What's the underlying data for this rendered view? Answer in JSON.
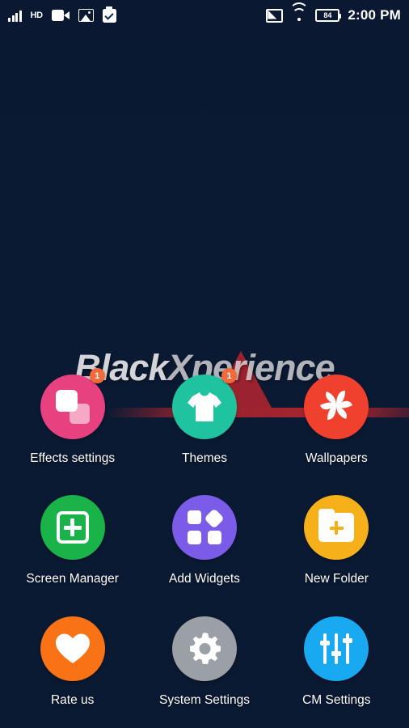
{
  "status_bar": {
    "left_icons": [
      "signal-bars-icon",
      "hd-icon",
      "video-camera-icon",
      "image-icon",
      "checkbox-checked-icon"
    ],
    "hd_label": "HD",
    "right_icons": [
      "cast-screen-icon",
      "wifi-icon",
      "battery-icon"
    ],
    "battery_level": "84",
    "clock": "2:00 PM"
  },
  "watermark": {
    "part1": "Black",
    "part2": "Xperience"
  },
  "apps": [
    {
      "label": "Effects settings",
      "icon": "effects-squares-icon",
      "color": "#e8417f",
      "badge": "1"
    },
    {
      "label": "Themes",
      "icon": "t-shirt-icon",
      "color": "#1fc3a0",
      "badge": "1"
    },
    {
      "label": "Wallpapers",
      "icon": "shutter-flower-icon",
      "color": "#f0402e",
      "badge": ""
    },
    {
      "label": "Screen Manager",
      "icon": "screen-plus-icon",
      "color": "#19b34a",
      "badge": ""
    },
    {
      "label": "Add Widgets",
      "icon": "widgets-shapes-icon",
      "color": "#7a5ce8",
      "badge": ""
    },
    {
      "label": "New Folder",
      "icon": "folder-plus-icon",
      "color": "#f6b01a",
      "badge": ""
    },
    {
      "label": "Rate us",
      "icon": "heart-icon",
      "color": "#f97316",
      "badge": ""
    },
    {
      "label": "System Settings",
      "icon": "gear-icon",
      "color": "#9aa0a6",
      "badge": ""
    },
    {
      "label": "CM Settings",
      "icon": "sliders-icon",
      "color": "#19a9f0",
      "badge": ""
    }
  ],
  "colors": {
    "background_top": "#13284c",
    "background_bottom": "#0c2244",
    "badge": "#f26a3a",
    "watermark_red": "#c4262e"
  }
}
